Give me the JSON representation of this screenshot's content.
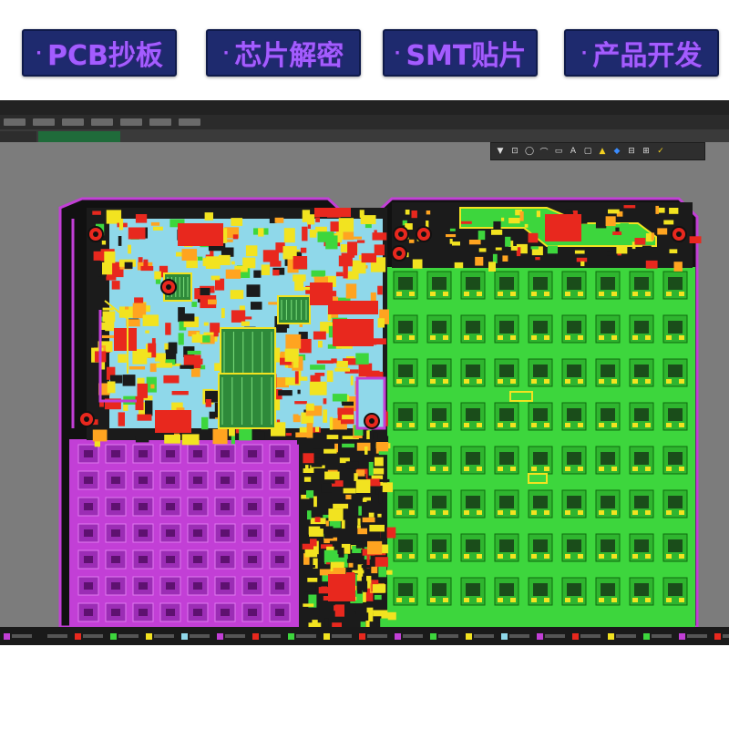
{
  "banner": {
    "buttons": [
      {
        "label": "PCB抄板",
        "bullet": "·"
      },
      {
        "label": "芯片解密",
        "bullet": "·"
      },
      {
        "label": "SMT贴片",
        "bullet": "·"
      },
      {
        "label": "产品开发",
        "bullet": "·"
      }
    ]
  },
  "colors": {
    "banner_bg": "#1e2a6e",
    "banner_text": "#a35cff",
    "board_bg": "#111111",
    "top_copper": "#3dd63d",
    "bottom_copper": "#c23fd6",
    "silkscreen": "#f2e320",
    "pads": "#e8281e",
    "keepout": "#8fd8ea"
  },
  "icons": {
    "toolbar": [
      "filter-icon",
      "select-icon",
      "zoom-icon",
      "route-icon",
      "place-icon",
      "text-icon",
      "pad-icon",
      "highlight-icon",
      "mark-icon",
      "measure-icon",
      "layer-icon",
      "drc-icon"
    ]
  }
}
